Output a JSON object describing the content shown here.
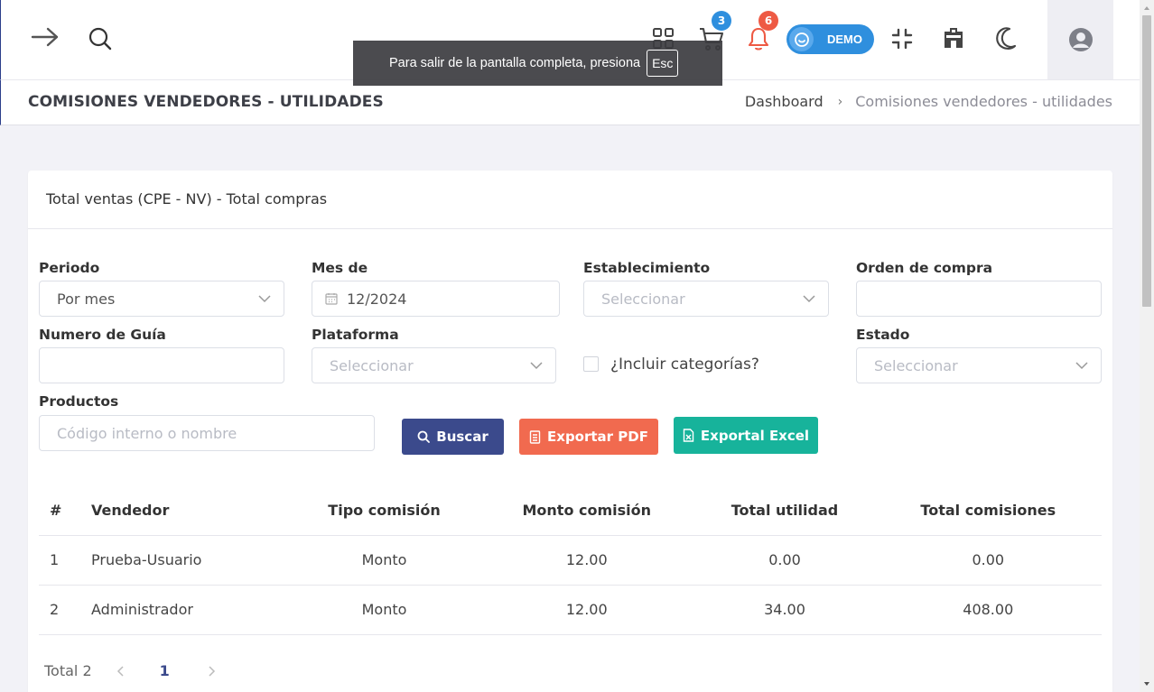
{
  "toast": {
    "text": "Para salir de la pantalla completa, presiona",
    "key": "Esc"
  },
  "topbar": {
    "cart_badge": "3",
    "notif_badge": "6",
    "demo_label": "DEMO",
    "colors": {
      "cart_badge": "#2f8fde",
      "notif_badge": "#ee5a44",
      "demo": "#2f8fde"
    }
  },
  "header": {
    "title": "COMISIONES VENDEDORES - UTILIDADES",
    "breadcrumb": {
      "home": "Dashboard",
      "sep": "›",
      "current": "Comisiones vendedores - utilidades"
    }
  },
  "card": {
    "title": "Total ventas (CPE - NV) - Total compras"
  },
  "filters": {
    "periodo": {
      "label": "Periodo",
      "value": "Por mes"
    },
    "mes": {
      "label": "Mes de",
      "value": "12/2024"
    },
    "establecimiento": {
      "label": "Establecimiento",
      "placeholder": "Seleccionar"
    },
    "orden": {
      "label": "Orden de compra",
      "value": ""
    },
    "guia": {
      "label": "Numero de Guía",
      "value": ""
    },
    "plataforma": {
      "label": "Plataforma",
      "placeholder": "Seleccionar"
    },
    "categorias": {
      "label": "¿Incluir categorías?",
      "checked": false
    },
    "estado": {
      "label": "Estado",
      "placeholder": "Seleccionar"
    },
    "productos": {
      "label": "Productos",
      "placeholder": "Código interno o nombre"
    }
  },
  "buttons": {
    "buscar": "Buscar",
    "pdf": "Exportar PDF",
    "excel": "Exportal Excel",
    "colors": {
      "buscar": "#3b4a8c",
      "pdf": "#f16a4f",
      "excel": "#17b39b"
    }
  },
  "table": {
    "headers": [
      "#",
      "Vendedor",
      "Tipo comisión",
      "Monto comisión",
      "Total utilidad",
      "Total comisiones"
    ],
    "rows": [
      [
        "1",
        "Prueba-Usuario",
        "Monto",
        "12.00",
        "0.00",
        "0.00"
      ],
      [
        "2",
        "Administrador",
        "Monto",
        "12.00",
        "34.00",
        "408.00"
      ]
    ]
  },
  "pagination": {
    "total": "Total 2",
    "current": "1"
  }
}
